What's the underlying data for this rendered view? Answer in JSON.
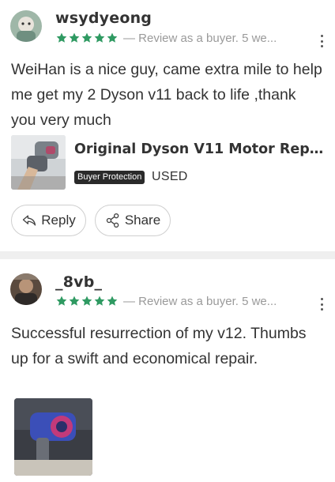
{
  "colors": {
    "star": "#2f9a62",
    "meta": "#9a9a9a",
    "badge_bg": "#2a2a2a",
    "divider": "#efefef"
  },
  "reviews": [
    {
      "username": "wsydyeong",
      "stars": 5,
      "meta": "— Review as a buyer.  5 we...",
      "more_icon": "more-vertical-icon",
      "text": "WeiHan is a nice guy, came extra mile to help me get my 2 Dyson v11 back to life ,thank you very much",
      "product": {
        "title": "Original Dyson V11 Motor Replac...",
        "badge": "Buyer Protection",
        "condition": "USED"
      },
      "actions": {
        "reply": "Reply",
        "share": "Share"
      }
    },
    {
      "username": "_8vb_",
      "stars": 5,
      "meta": "— Review as a buyer.  5 we...",
      "more_icon": "more-vertical-icon",
      "text": "Successful resurrection of my v12. Thumbs up for a swift and economical repair."
    }
  ]
}
